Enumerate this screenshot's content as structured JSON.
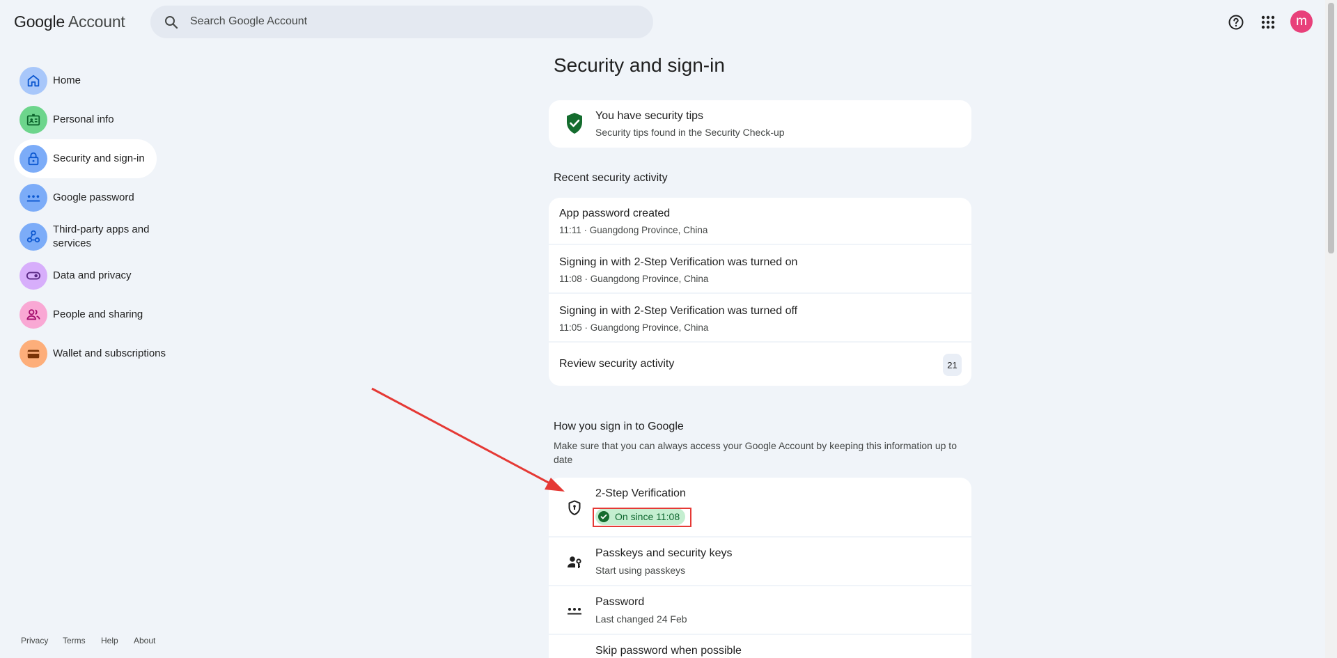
{
  "header": {
    "logo_google": "Google",
    "logo_account": "Account",
    "search_placeholder": "Search Google Account",
    "avatar_letter": "m"
  },
  "sidebar": {
    "items": [
      {
        "label": "Home",
        "color": "#a8c7fa",
        "icon": "home-icon"
      },
      {
        "label": "Personal info",
        "color": "#6dd58c",
        "icon": "id-card-icon"
      },
      {
        "label": "Security and sign-in",
        "color": "#7cacf8",
        "icon": "lock-icon",
        "active": true
      },
      {
        "label": "Google password",
        "color": "#7cacf8",
        "icon": "password-dots-icon"
      },
      {
        "label": "Third-party apps and services",
        "color": "#7cacf8",
        "icon": "connected-apps-icon"
      },
      {
        "label": "Data and privacy",
        "color": "#d7aefb",
        "icon": "toggle-icon"
      },
      {
        "label": "People and sharing",
        "color": "#f9a8d4",
        "icon": "people-icon"
      },
      {
        "label": "Wallet and subscriptions",
        "color": "#fdae7a",
        "icon": "wallet-icon"
      }
    ],
    "footer": [
      "Privacy",
      "Terms",
      "Help",
      "About"
    ]
  },
  "main": {
    "title": "Security and sign-in",
    "tips": {
      "title": "You have security tips",
      "subtitle": "Security tips found in the Security Check-up"
    },
    "recent_activity": {
      "heading": "Recent security activity",
      "items": [
        {
          "title": "App password created",
          "detail": "11:11 · Guangdong Province, China"
        },
        {
          "title": "Signing in with 2-Step Verification was turned on",
          "detail": "11:08 · Guangdong Province, China"
        },
        {
          "title": "Signing in with 2-Step Verification was turned off",
          "detail": "11:05 · Guangdong Province, China"
        }
      ],
      "review_label": "Review security activity",
      "review_count": "21"
    },
    "how_sign_in": {
      "heading": "How you sign in to Google",
      "description": "Make sure that you can always access your Google Account by keeping this information up to date",
      "items": [
        {
          "title": "2-Step Verification",
          "status": "On since 11:08",
          "icon": "shield-icon"
        },
        {
          "title": "Passkeys and security keys",
          "detail": "Start using passkeys",
          "icon": "passkey-icon"
        },
        {
          "title": "Password",
          "detail": "Last changed 24 Feb",
          "icon": "password-dots-icon"
        },
        {
          "title": "Skip password when possible",
          "icon": "skip-password-icon"
        }
      ]
    }
  },
  "colors": {
    "background": "#f0f4f9",
    "accent_green": "#146c2e",
    "annotation_red": "#e53935"
  }
}
